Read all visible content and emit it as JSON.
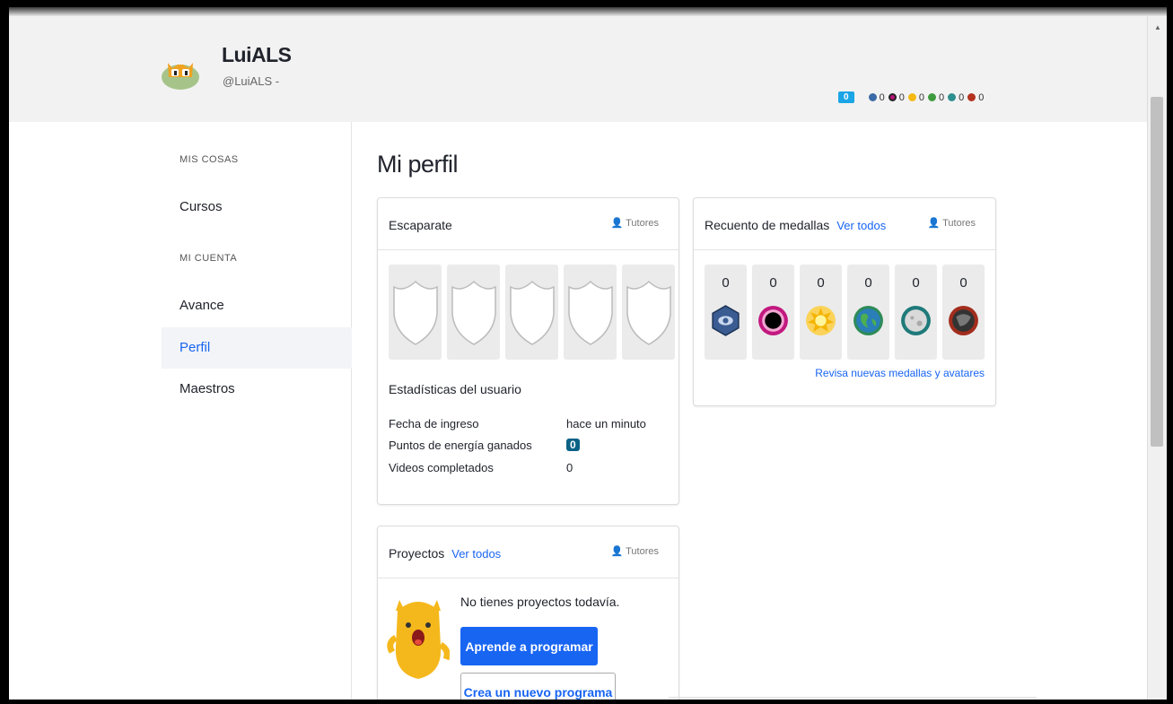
{
  "header": {
    "username": "LuiALS",
    "handle": "@LuiALS -",
    "energy_points": "0",
    "badge_counts": [
      {
        "icon": "meteorite-badge",
        "color": "#3b6aa6",
        "count": "0"
      },
      {
        "icon": "moon-badge",
        "color": "#b5157a",
        "count": "0"
      },
      {
        "icon": "earth-badge",
        "color": "#f5b912",
        "count": "0"
      },
      {
        "icon": "sun-badge",
        "color": "#3f9b3f",
        "count": "0"
      },
      {
        "icon": "black-hole-badge",
        "color": "#2d8f8f",
        "count": "0"
      },
      {
        "icon": "challenge-patch",
        "color": "#b4321e",
        "count": "0"
      }
    ]
  },
  "sidebar": {
    "section1_heading": "MIS COSAS",
    "section1_items": [
      {
        "label": "Cursos"
      }
    ],
    "section2_heading": "MI CUENTA",
    "section2_items": [
      {
        "label": "Avance"
      },
      {
        "label": "Perfil",
        "active": true
      },
      {
        "label": "Maestros"
      }
    ]
  },
  "main": {
    "title": "Mi perfil"
  },
  "showcase": {
    "title": "Escaparate",
    "tutores_label": "Tutores",
    "stats_title": "Estadísticas del usuario",
    "stats": [
      {
        "label": "Fecha de ingreso",
        "value": "hace un minuto"
      },
      {
        "label": "Puntos de energía ganados",
        "value": "0"
      },
      {
        "label": "Videos completados",
        "value": "0"
      }
    ]
  },
  "medals": {
    "title": "Recuento de medallas",
    "ver_todos": "Ver todos",
    "tutores_label": "Tutores",
    "items": [
      {
        "name": "meteorite-medal",
        "count": "0",
        "color": "#3a5c92"
      },
      {
        "name": "moon-medal",
        "count": "0",
        "color": "#c2197f"
      },
      {
        "name": "earth-medal",
        "count": "0",
        "color": "#f4b400"
      },
      {
        "name": "sun-medal",
        "count": "0",
        "color": "#2e8b57"
      },
      {
        "name": "black-hole-medal",
        "count": "0",
        "color": "#1f7a7a"
      },
      {
        "name": "challenge-patch-medal",
        "count": "0",
        "color": "#a22d1d"
      }
    ],
    "link": "Revisa nuevas medallas y avatares"
  },
  "projects": {
    "title": "Proyectos",
    "ver_todos": "Ver todos",
    "tutores_label": "Tutores",
    "empty_text": "No tienes proyectos todavía.",
    "primary_button": "Aprende a programar",
    "secondary_button": "Crea un nuevo programa"
  }
}
